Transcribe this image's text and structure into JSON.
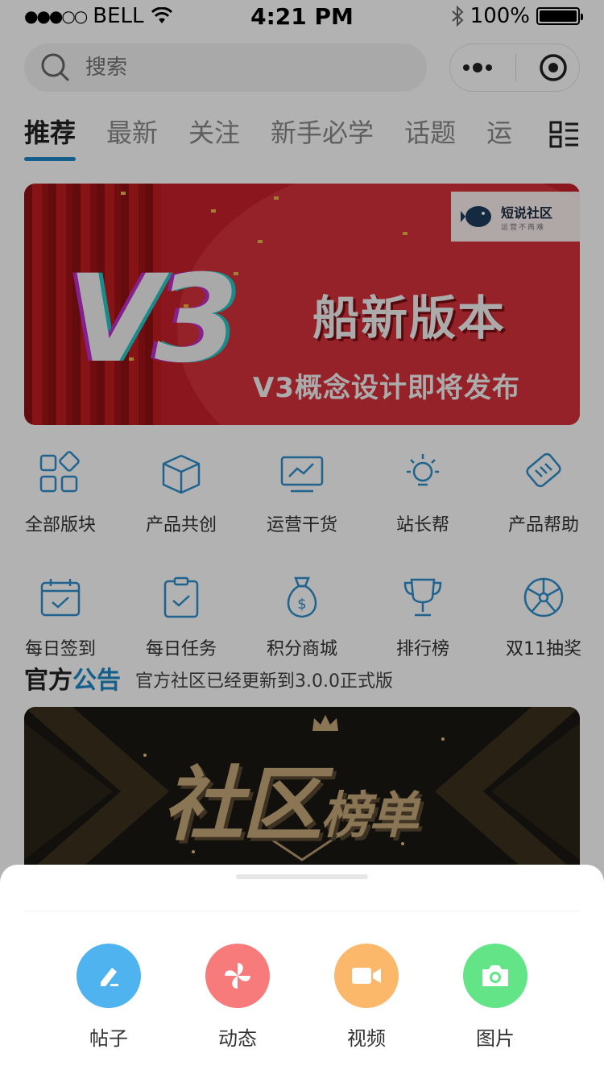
{
  "status_bar": {
    "carrier": "BELL",
    "time": "4:21 PM",
    "battery": "100%"
  },
  "search": {
    "placeholder": "搜索"
  },
  "tabs": [
    {
      "label": "推荐",
      "active": true
    },
    {
      "label": "最新"
    },
    {
      "label": "关注"
    },
    {
      "label": "新手必学"
    },
    {
      "label": "话题"
    },
    {
      "label": "运"
    }
  ],
  "banner": {
    "logo_text": "V3",
    "title": "船新版本",
    "subtitle": "V3概念设计即将发布",
    "badge_name": "短说社区",
    "badge_slogan": "运营不再难"
  },
  "grid": {
    "row1": [
      {
        "label": "全部版块",
        "icon": "grid-icon"
      },
      {
        "label": "产品共创",
        "icon": "box-icon"
      },
      {
        "label": "运营干货",
        "icon": "chart-monitor-icon"
      },
      {
        "label": "站长帮",
        "icon": "lightbulb-icon"
      },
      {
        "label": "产品帮助",
        "icon": "handshake-icon"
      }
    ],
    "row2": [
      {
        "label": "每日签到",
        "icon": "calendar-check-icon"
      },
      {
        "label": "每日任务",
        "icon": "clipboard-check-icon"
      },
      {
        "label": "积分商城",
        "icon": "money-bag-icon"
      },
      {
        "label": "排行榜",
        "icon": "trophy-icon"
      },
      {
        "label": "双11抽奖",
        "icon": "lottery-wheel-icon"
      }
    ]
  },
  "announce": {
    "title_a": "官方",
    "title_b": "公告",
    "text": "官方社区已经更新到3.0.0正式版"
  },
  "banner2": {
    "title_a": "社区",
    "title_b": "榜单"
  },
  "sheet": {
    "actions": [
      {
        "label": "帖子",
        "icon": "pencil-icon",
        "color": "#4fb3f0"
      },
      {
        "label": "动态",
        "icon": "pinwheel-icon",
        "color": "#f77b7b"
      },
      {
        "label": "视频",
        "icon": "video-camera-icon",
        "color": "#fbb86a"
      },
      {
        "label": "图片",
        "icon": "camera-icon",
        "color": "#63e487"
      }
    ]
  },
  "colors": {
    "accent": "#1e88c8",
    "icon_blue": "#2e8fcc"
  }
}
